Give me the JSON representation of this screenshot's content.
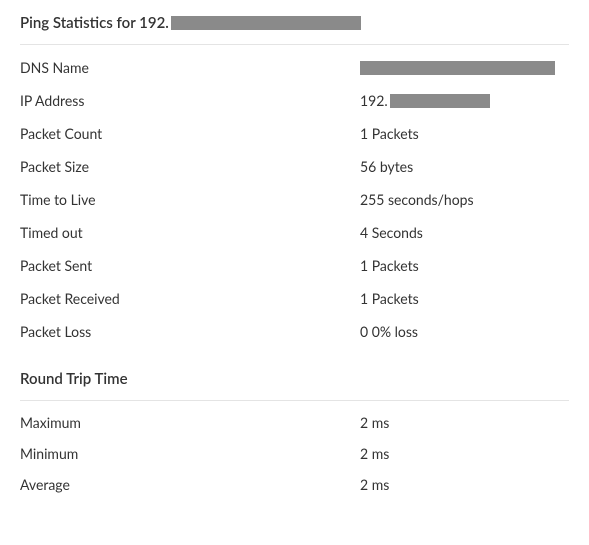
{
  "header": {
    "title_prefix": "Ping Statistics for 192."
  },
  "stats": {
    "dns_name": {
      "label": "DNS Name"
    },
    "ip_address": {
      "label": "IP Address",
      "value_prefix": "192."
    },
    "packet_count": {
      "label": "Packet Count",
      "value": "1 Packets"
    },
    "packet_size": {
      "label": "Packet Size",
      "value": "56 bytes"
    },
    "ttl": {
      "label": "Time to Live",
      "value": "255 seconds/hops"
    },
    "timed_out": {
      "label": "Timed out",
      "value": "4 Seconds"
    },
    "packet_sent": {
      "label": "Packet Sent",
      "value": "1 Packets"
    },
    "packet_received": {
      "label": "Packet Received",
      "value": "1 Packets"
    },
    "packet_loss": {
      "label": "Packet Loss",
      "value": "0 0% loss"
    }
  },
  "rtt": {
    "title": "Round Trip Time",
    "maximum": {
      "label": "Maximum",
      "value": "2 ms"
    },
    "minimum": {
      "label": "Minimum",
      "value": "2 ms"
    },
    "average": {
      "label": "Average",
      "value": "2 ms"
    }
  }
}
